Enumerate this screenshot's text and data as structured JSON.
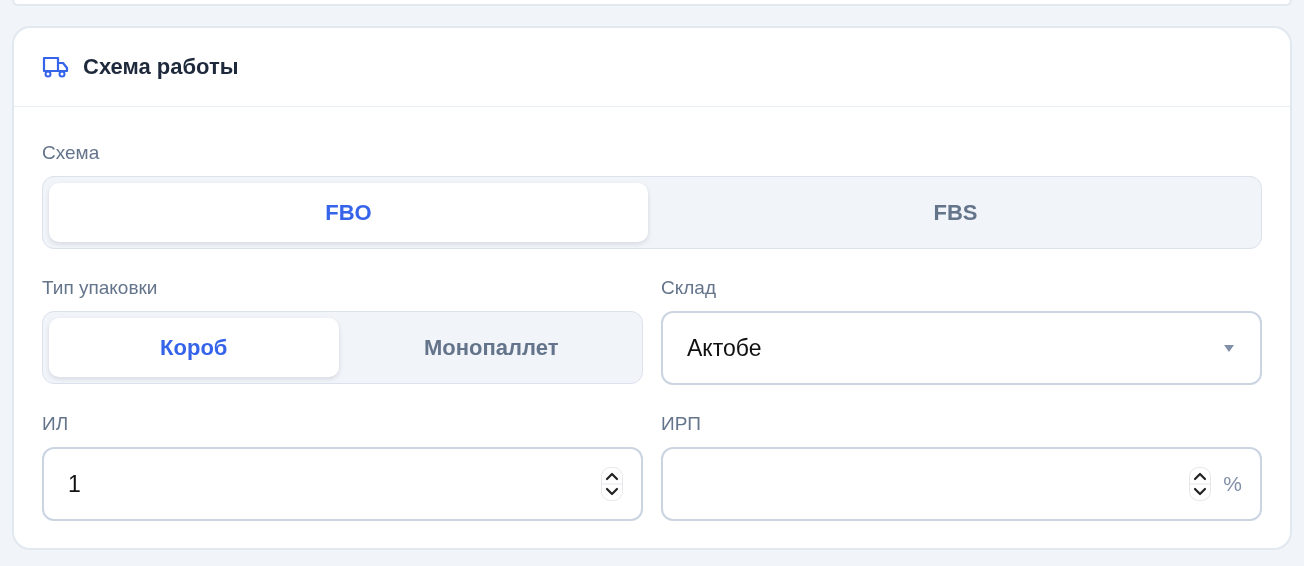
{
  "header": {
    "title": "Схема работы"
  },
  "scheme": {
    "label": "Схема",
    "options": [
      {
        "label": "FBO",
        "selected": true
      },
      {
        "label": "FBS",
        "selected": false
      }
    ]
  },
  "packaging": {
    "label": "Тип упаковки",
    "options": [
      {
        "label": "Короб",
        "selected": true
      },
      {
        "label": "Монопаллет",
        "selected": false
      }
    ]
  },
  "warehouse": {
    "label": "Склад",
    "value": "Актобе"
  },
  "il": {
    "label": "ИЛ",
    "value": "1"
  },
  "irp": {
    "label": "ИРП",
    "suffix": "%"
  }
}
